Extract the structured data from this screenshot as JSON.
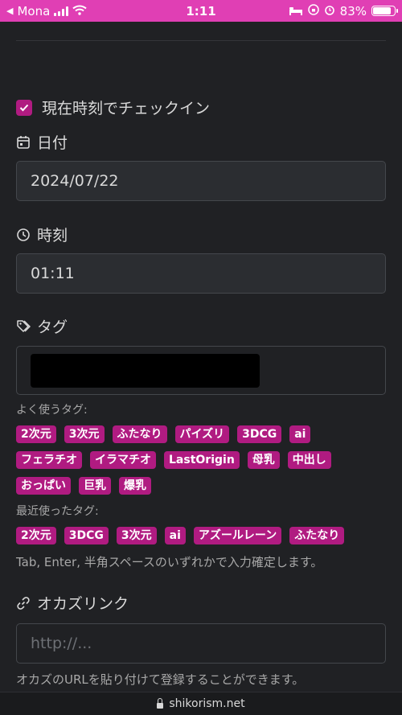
{
  "status_bar": {
    "carrier": "Mona",
    "time": "1:11",
    "battery": "83%"
  },
  "checkin": {
    "label": "現在時刻でチェックイン",
    "checked": true
  },
  "date": {
    "label": "日付",
    "value": "2024/07/22"
  },
  "time": {
    "label": "時刻",
    "value": "01:11"
  },
  "tags": {
    "label": "タグ",
    "frequent_label": "よく使うタグ:",
    "frequent_rows": [
      [
        "2次元",
        "3次元",
        "ふたなり",
        "パイズリ",
        "3DCG",
        "ai"
      ],
      [
        "フェラチオ",
        "イラマチオ",
        "LastOrigin",
        "母乳",
        "中出し"
      ],
      [
        "おっぱい",
        "巨乳",
        "爆乳"
      ]
    ],
    "recent_label": "最近使ったタグ:",
    "recent": [
      "2次元",
      "3DCG",
      "3次元",
      "ai",
      "アズールレーン",
      "ふたなり"
    ],
    "help": "Tab, Enter, 半角スペースのいずれかで入力確定します。"
  },
  "okazu": {
    "label": "オカズリンク",
    "placeholder": "http://...",
    "help": "オカズのURLを貼り付けて登録することができます。"
  },
  "url_bar": {
    "domain": "shikorism.net"
  },
  "colors": {
    "accent": "#b01b81",
    "status_bar": "#e03fb4",
    "background": "#202124"
  }
}
